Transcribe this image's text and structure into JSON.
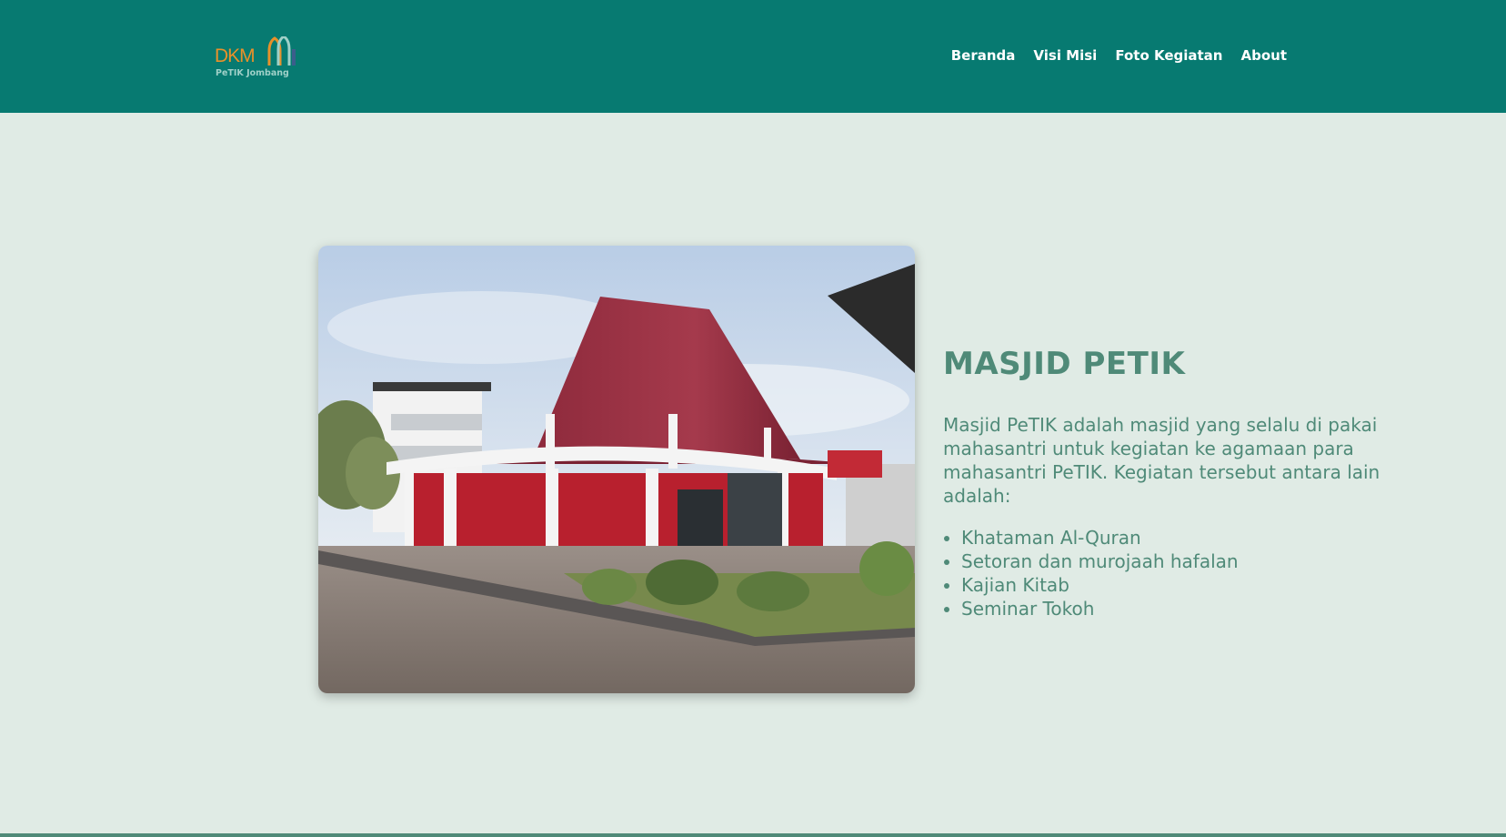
{
  "header": {
    "logo": {
      "main": "DKM",
      "sub": "PeTIK Jombang"
    },
    "nav": [
      {
        "label": "Beranda"
      },
      {
        "label": "Visi Misi"
      },
      {
        "label": "Foto Kegiatan"
      },
      {
        "label": "About"
      }
    ]
  },
  "main": {
    "title": "MASJID PETIK",
    "description": "Masjid PeTIK adalah masjid yang selalu di pakai mahasantri untuk kegiatan ke agamaan para mahasantri PeTIK. Kegiatan tersebut antara lain adalah:",
    "activities": [
      "Khataman Al-Quran",
      "Setoran dan murojaah hafalan",
      "Kajian Kitab",
      "Seminar Tokoh"
    ]
  },
  "colors": {
    "navbar": "#077a71",
    "background": "#e0ebe5",
    "text": "#4f8a78",
    "logo_accent": "#e8912a"
  }
}
